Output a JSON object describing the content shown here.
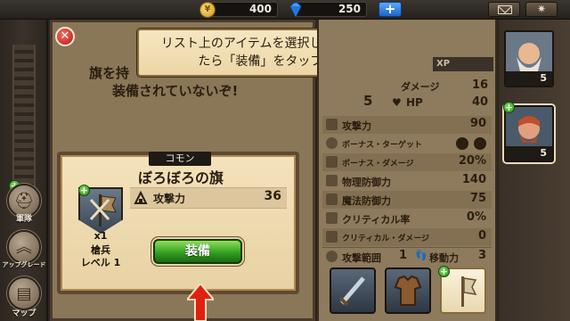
{
  "topbar": {
    "gold": "400",
    "gems": "250",
    "add_label": "+",
    "icons": {
      "gold": "coin-icon",
      "gems": "gem-icon",
      "mail": "mail-icon",
      "settings": "gear-icon"
    }
  },
  "sidebar": {
    "items": [
      {
        "label": "軍隊",
        "icon": "helmet-icon"
      },
      {
        "label": "アップグレード",
        "icon": "chevron-up-icon"
      },
      {
        "label": "マップ",
        "icon": "map-icon"
      }
    ]
  },
  "parchment": {
    "message_line1": "旗を持",
    "message_line2": "装備されていないぞ!"
  },
  "tooltip": {
    "line1": "リスト上のアイテムを選択して効果を確認し",
    "line2": "たら「装備」をタップしよう。"
  },
  "item": {
    "rarity": "コモン",
    "name": "ぼろぼろの旗",
    "stat_label": "攻撃力",
    "stat_value": "36",
    "quantity": "x1",
    "unit_name": "槍兵",
    "unit_level": "レベル 1",
    "equip_label": "装備"
  },
  "stats": {
    "xp_label": "XP",
    "level": "5",
    "damage_label": "ダメージ",
    "damage_value": "16",
    "hp_label": "HP",
    "hp_value": "40",
    "rows": [
      {
        "label": "攻撃力",
        "value": "90",
        "icon": "sword-icon"
      },
      {
        "label": "ボーナス・ターゲット",
        "value": "",
        "icon": "target-icon"
      },
      {
        "label": "ボーナス・ダメージ",
        "value": "20%",
        "icon": "burst-icon"
      },
      {
        "label": "物理防御力",
        "value": "140",
        "icon": "shield-icon"
      },
      {
        "label": "魔法防御力",
        "value": "75",
        "icon": "magic-shield-icon"
      },
      {
        "label": "クリティカル率",
        "value": "0%",
        "icon": "crit-icon"
      },
      {
        "label": "クリティカル・ダメージ",
        "value": "0",
        "icon": "crit-damage-icon"
      }
    ],
    "range_label": "攻撃範囲",
    "range_value": "1",
    "move_label": "移動力",
    "move_value": "3"
  },
  "heroes": [
    {
      "level": "5"
    },
    {
      "level": "5"
    }
  ],
  "colors": {
    "equip_green": "#2e9a1e",
    "close_red": "#b01818",
    "parchment": "#f4e2bc",
    "plus_blue": "#1f64c8"
  }
}
